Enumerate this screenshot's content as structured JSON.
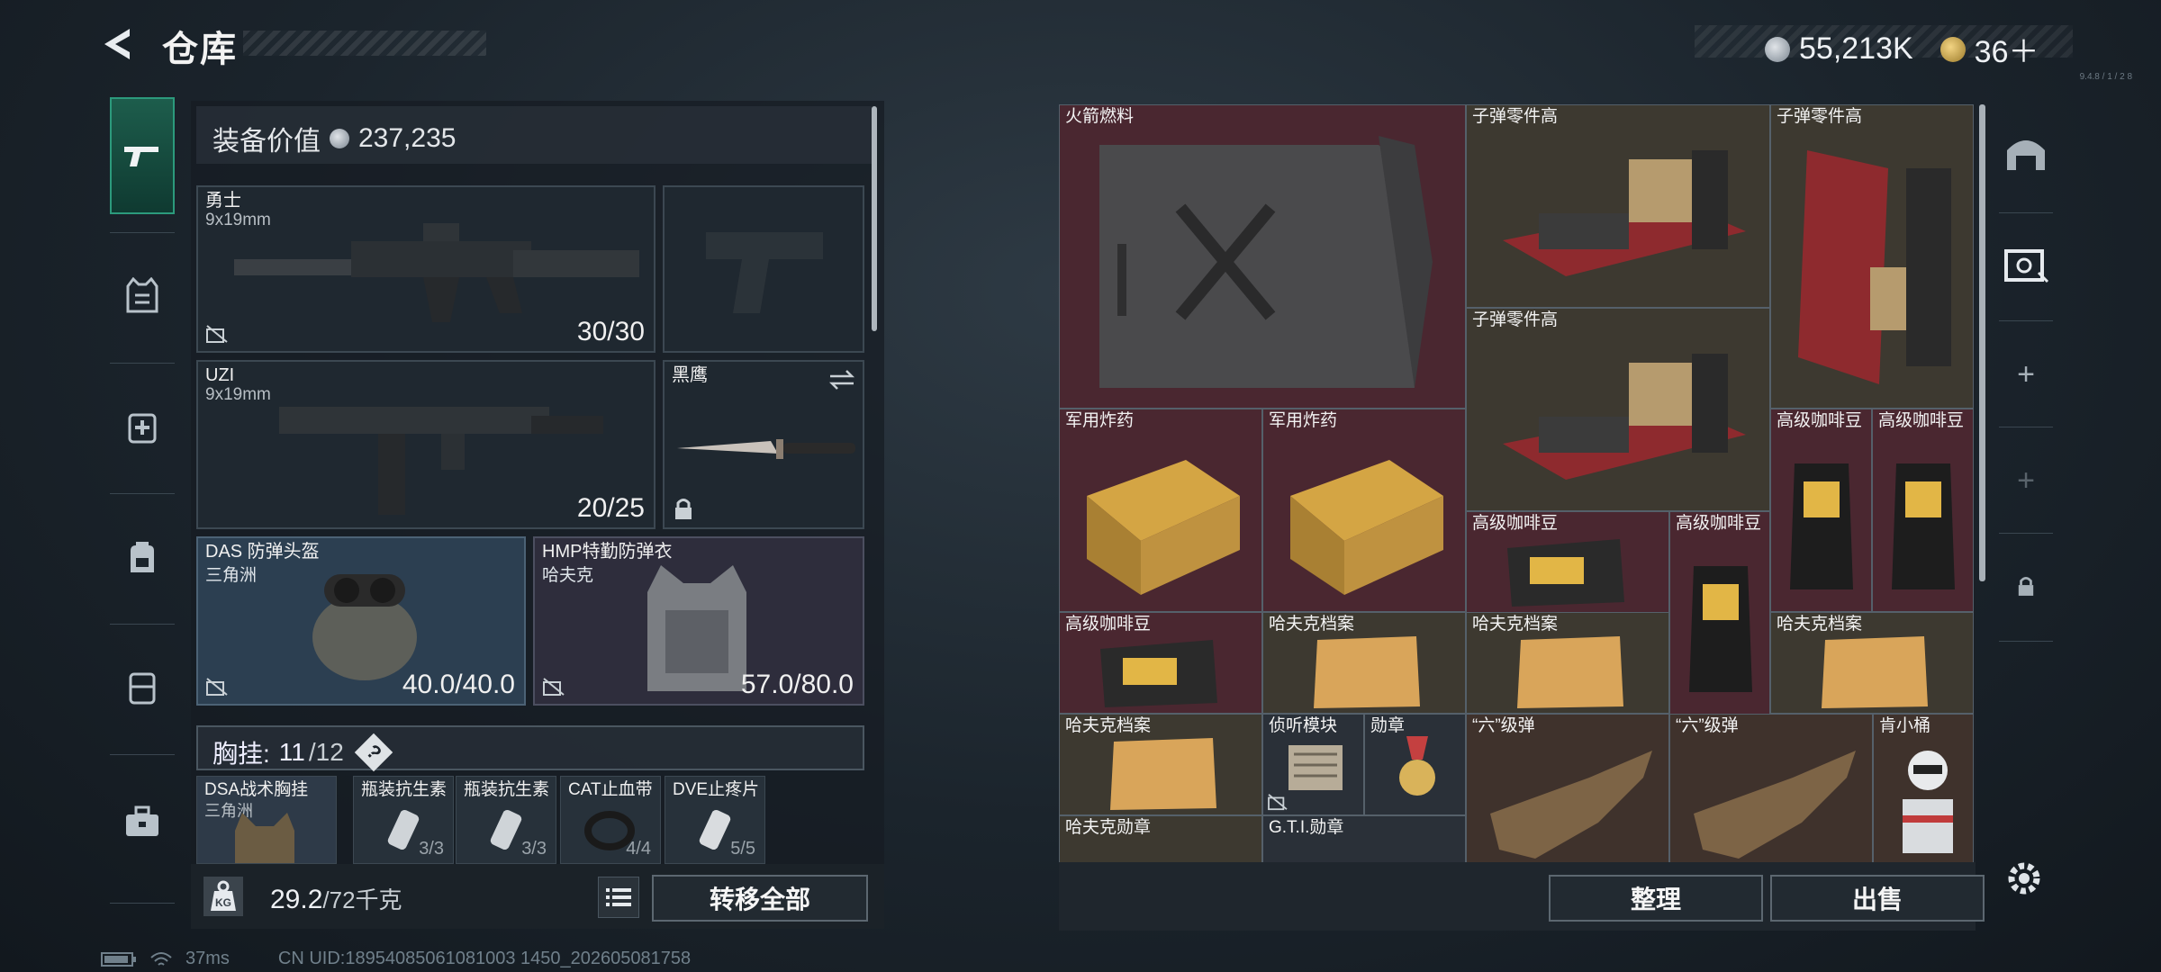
{
  "header": {
    "title": "仓库",
    "currency1": "55,213K",
    "currency2": "36＋",
    "note": "9.4.8 / 1 / 2 8"
  },
  "equipment": {
    "value_label": "装备价值",
    "value": "237,235",
    "primary": {
      "name": "勇士",
      "caliber": "9x19mm",
      "ammo": "30/30"
    },
    "secondary": {
      "name": "UZI",
      "caliber": "9x19mm",
      "ammo": "20/25"
    },
    "melee": {
      "name": "黑鹰"
    },
    "helmet": {
      "name": "DAS 防弹头盔",
      "brand": "三角洲",
      "durability": "40.0/40.0"
    },
    "armor": {
      "name": "HMP特勤防弹衣",
      "brand": "哈夫克",
      "durability": "57.0/80.0"
    },
    "chest_rig": {
      "label": "胸挂:",
      "used": "11",
      "total": "/12",
      "help": "?"
    },
    "rig_items": [
      {
        "name": "DSA战术胸挂",
        "sub": "三角洲",
        "count": ""
      },
      {
        "name": "瓶装抗生素",
        "count": "3/3"
      },
      {
        "name": "瓶装抗生素",
        "count": "3/3"
      },
      {
        "name": "CAT止血带",
        "count": "4/4"
      },
      {
        "name": "DVE止疼片",
        "count": "5/5"
      }
    ],
    "weight": "29.2",
    "weight_max": "/72千克",
    "transfer_all": "转移全部"
  },
  "storage": {
    "items": [
      {
        "name": "火箭燃料"
      },
      {
        "name": "子弹零件高"
      },
      {
        "name": "子弹零件高"
      },
      {
        "name": "子弹零件高"
      },
      {
        "name": "军用炸药"
      },
      {
        "name": "军用炸药"
      },
      {
        "name": "高级咖啡豆"
      },
      {
        "name": "高级咖啡豆"
      },
      {
        "name": "高级咖啡豆"
      },
      {
        "name": "高级咖啡豆"
      },
      {
        "name": "高级咖啡豆"
      },
      {
        "name": "哈夫克档案"
      },
      {
        "name": "哈夫克档案"
      },
      {
        "name": "哈夫克档案"
      },
      {
        "name": "哈夫克档案"
      },
      {
        "name": "侦听模块"
      },
      {
        "name": "勋章"
      },
      {
        "name": "“六”级弹"
      },
      {
        "name": "“六”级弹"
      },
      {
        "name": "肯小桶"
      },
      {
        "name": "哈夫克勋章"
      },
      {
        "name": "G.T.I.勋章"
      }
    ],
    "sort_button": "整理",
    "sell_button": "出售"
  },
  "footer": {
    "ping": "37ms",
    "uid": "CN UID:18954085061081003 1450_202605081758"
  },
  "colors": {
    "accent": "#2c9a7c",
    "red_cell": "#4a2730",
    "tan_cell": "#3d3930"
  }
}
